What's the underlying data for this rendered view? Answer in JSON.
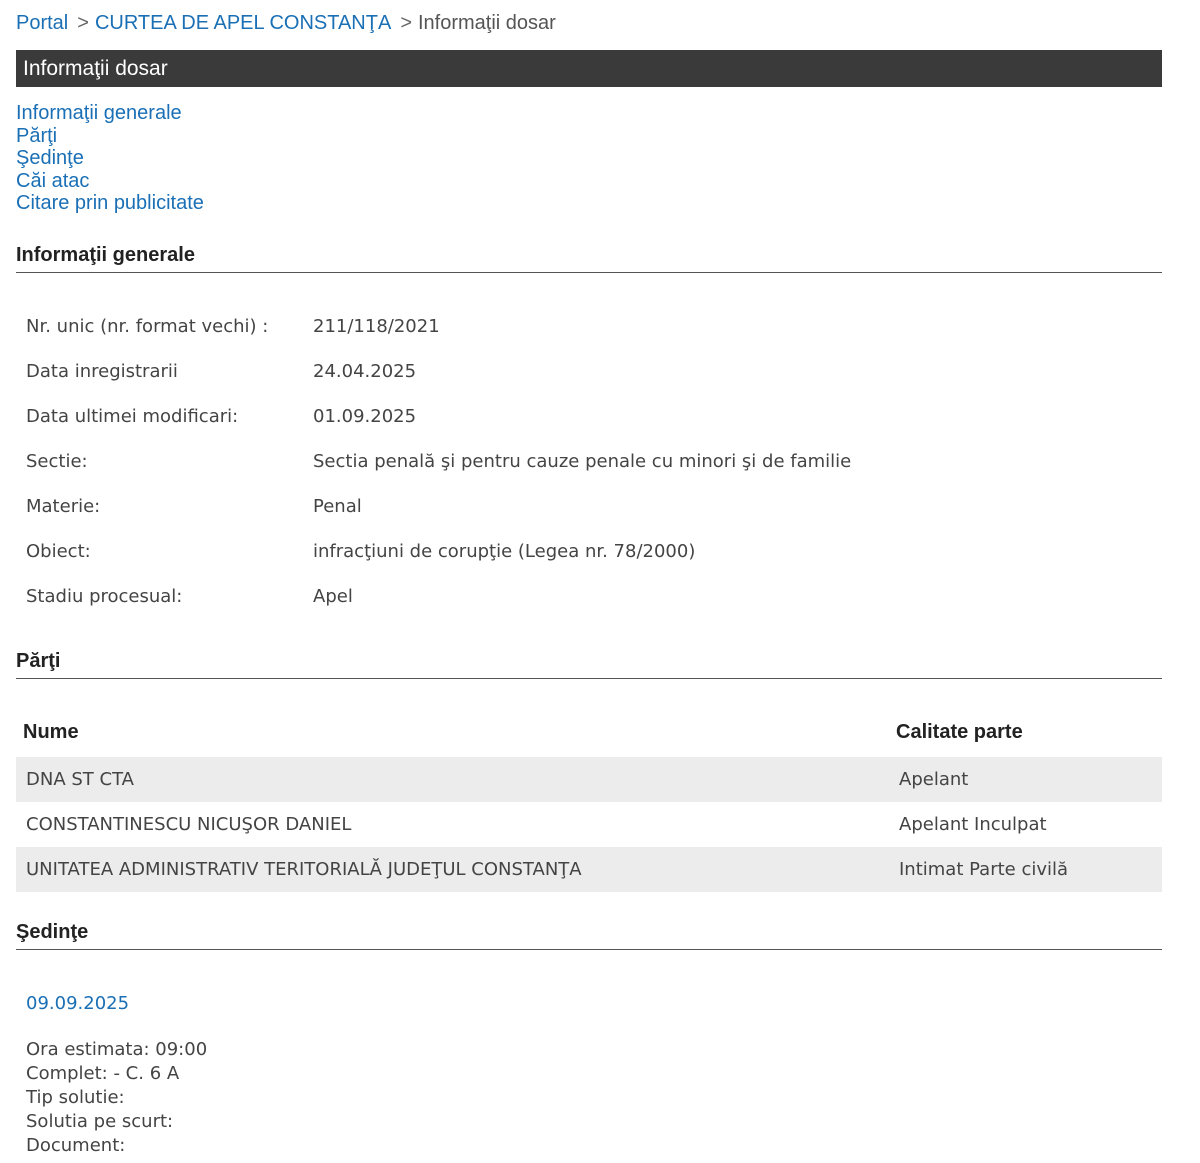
{
  "breadcrumb": {
    "portal": "Portal",
    "sep": ">",
    "court": "CURTEA DE APEL CONSTANŢA",
    "current": "Informaţii dosar"
  },
  "page_title": "Informaţii dosar",
  "nav": [
    "Informaţii generale",
    "Părţi",
    "Şedinţe",
    "Căi atac",
    "Citare prin publicitate"
  ],
  "general": {
    "heading": "Informaţii generale",
    "rows": [
      {
        "label": "Nr. unic (nr. format vechi) :",
        "value": "211/118/2021"
      },
      {
        "label": "Data inregistrarii",
        "value": "24.04.2025"
      },
      {
        "label": "Data ultimei modificari:",
        "value": "01.09.2025"
      },
      {
        "label": "Sectie:",
        "value": "Sectia penală şi pentru cauze penale cu minori şi de familie"
      },
      {
        "label": "Materie:",
        "value": "Penal"
      },
      {
        "label": "Obiect:",
        "value": "infracţiuni de corupţie (Legea nr. 78/2000)"
      },
      {
        "label": "Stadiu procesual:",
        "value": "Apel"
      }
    ]
  },
  "parties": {
    "heading": "Părţi",
    "col_name": "Nume",
    "col_role": "Calitate parte",
    "rows": [
      {
        "name": "DNA ST CTA",
        "role": "Apelant"
      },
      {
        "name": "CONSTANTINESCU NICUŞOR DANIEL",
        "role": "Apelant Inculpat"
      },
      {
        "name": "UNITATEA ADMINISTRATIV TERITORIALĂ JUDEŢUL CONSTANŢA",
        "role": "Intimat Parte civilă"
      }
    ]
  },
  "sessions": {
    "heading": "Şedinţe",
    "date": "09.09.2025",
    "details": [
      "Ora estimata: 09:00",
      "Complet: - C. 6 A",
      "Tip solutie:",
      "Solutia pe scurt:",
      "Document:"
    ]
  },
  "colors": {
    "link": "#1a6fb5",
    "title_bar": "#3a3a3a",
    "row_shade": "#ececec"
  }
}
